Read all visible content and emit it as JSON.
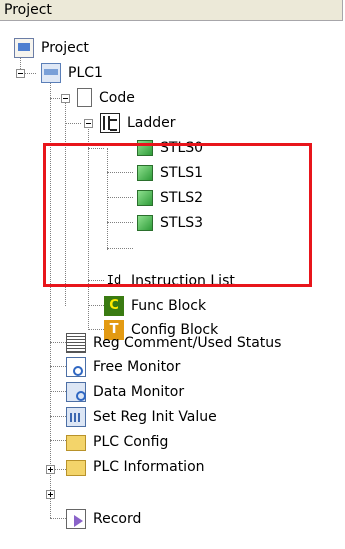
{
  "panel": {
    "title": "Project"
  },
  "tree": {
    "project": "Project",
    "plc": "PLC1",
    "code": "Code",
    "ladder": "Ladder",
    "stls0": "STLS0",
    "stls1": "STLS1",
    "stls2": "STLS2",
    "stls3": "STLS3",
    "il_icon": "Id",
    "instruction_list": "Instruction List",
    "fb_icon": "C",
    "func_block": "Func Block",
    "cb_icon": "T",
    "config_block": "Config Block",
    "reg_comment": "Reg Comment/Used Status",
    "free_monitor": "Free Monitor",
    "data_monitor": "Data Monitor",
    "set_reg_init": "Set Reg Init Value",
    "plc_config": "PLC Config",
    "plc_information": "PLC Information",
    "record": "Record"
  },
  "colors": {
    "highlight": "#e8151b",
    "header_bg": "#ece9d8"
  }
}
